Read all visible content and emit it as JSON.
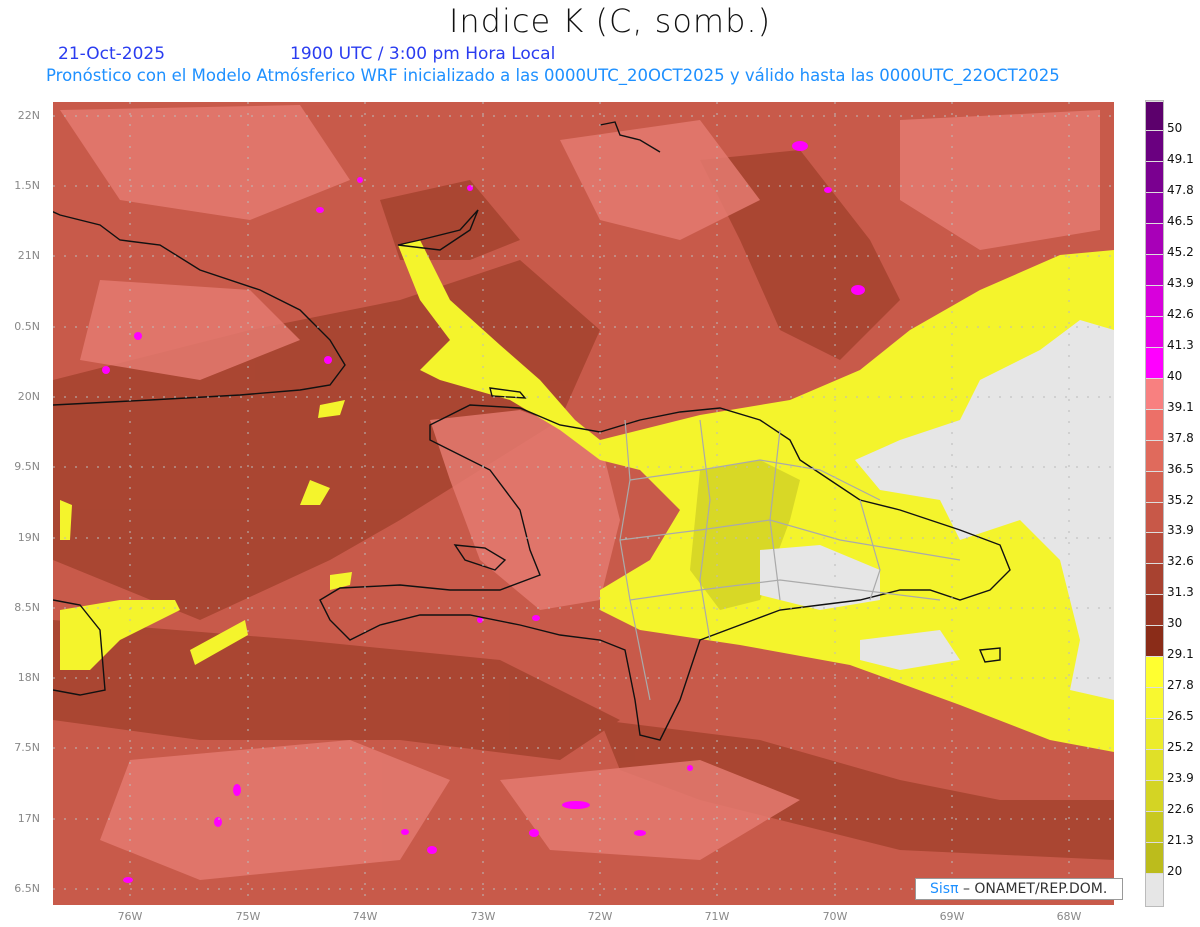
{
  "header": {
    "title": "Indice K (C, somb.)",
    "date": "21-Oct-2025",
    "time": "1900 UTC / 3:00 pm Hora Local",
    "subtitle": "Pronóstico con el Modelo Atmósferico WRF inicializado a las 0000UTC_20OCT2025 y válido hasta las  0000UTC_22OCT2025"
  },
  "axes": {
    "lat_labels": [
      "22N",
      "1.5N",
      "21N",
      "0.5N",
      "20N",
      "9.5N",
      "19N",
      "8.5N",
      "18N",
      "7.5N",
      "17N",
      "6.5N"
    ],
    "lon_labels": [
      "76W",
      "75W",
      "74W",
      "73W",
      "72W",
      "71W",
      "70W",
      "69W",
      "68W"
    ]
  },
  "colorbar": {
    "labels": [
      "50",
      "49.1",
      "47.8",
      "46.5",
      "45.2",
      "43.9",
      "42.6",
      "41.3",
      "40",
      "39.1",
      "37.8",
      "36.5",
      "35.2",
      "33.9",
      "32.6",
      "31.3",
      "30",
      "29.1",
      "27.8",
      "26.5",
      "25.2",
      "23.9",
      "22.6",
      "21.3",
      "20"
    ],
    "colors": [
      "#5c006c",
      "#6a0080",
      "#7a0090",
      "#9000a8",
      "#a800b8",
      "#c000cc",
      "#d800dc",
      "#e800e8",
      "#ff00ff",
      "#f88080",
      "#ec7068",
      "#e06a5c",
      "#d46050",
      "#c85848",
      "#b84c3c",
      "#a84230",
      "#983624",
      "#8a2c18",
      "#ffff30",
      "#f8f830",
      "#ecec2c",
      "#e0e028",
      "#d4d424",
      "#c8c820",
      "#bcbc1c",
      "#e6e6e6"
    ]
  },
  "credit": {
    "logo": "Sisπ",
    "text": "– ONAMET/REP.DOM."
  }
}
